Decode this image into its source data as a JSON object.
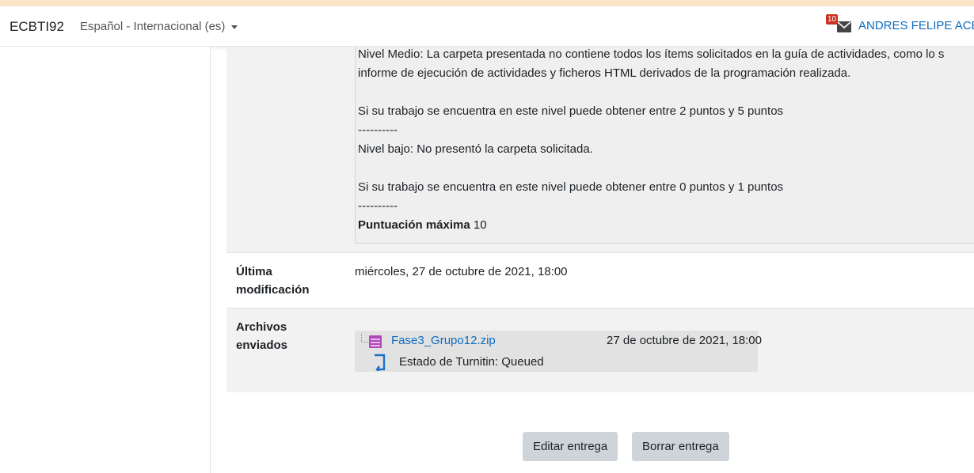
{
  "navbar": {
    "brand": "ECBTI92",
    "language": "Español - Internacional (es)",
    "message_count": "10",
    "user_name": "ANDRES FELIPE ACEVEDO"
  },
  "rubric": {
    "lines": [
      "Nivel Medio: La carpeta presentada no contiene todos los ítems solicitados en la guía de actividades, como lo s",
      "informe de ejecución de actividades y ficheros HTML derivados de la programación realizada.",
      "Si su trabajo se encuentra en este nivel puede obtener entre 2 puntos y 5 puntos",
      "----------",
      "Nivel bajo: No presentó la carpeta solicitada.",
      "Si su trabajo se encuentra en este nivel puede obtener entre 0 puntos y 1 puntos",
      "----------"
    ],
    "max_score_label": "Puntuación máxima",
    "max_score_value": "10"
  },
  "last_modified": {
    "label_line1": "Última",
    "label_line2": "modificación",
    "value": "miércoles, 27 de octubre de 2021, 18:00"
  },
  "files": {
    "label_line1": "Archivos",
    "label_line2": "enviados",
    "file_name": "Fase3_Grupo12.zip",
    "file_date": "27 de octubre de 2021, 18:00",
    "turnitin_status": "Estado de Turnitin: Queued"
  },
  "actions": {
    "edit_label": "Editar entrega",
    "delete_label": "Borrar entrega"
  },
  "colors": {
    "link": "#0f6cbf",
    "badge": "#ca3120",
    "zip_icon": "#b04ab8",
    "turnitin_icon": "#1a73c7"
  }
}
